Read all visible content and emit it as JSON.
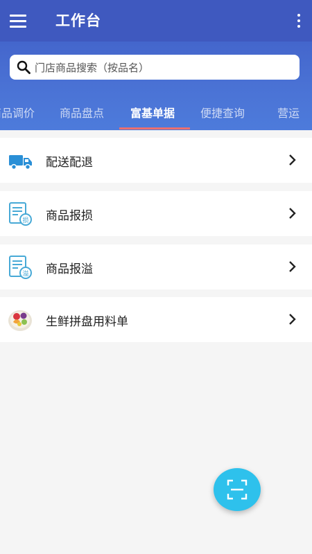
{
  "app_bar": {
    "title": "工作台",
    "menu_icon": "hamburger-menu-icon",
    "more_icon": "more-vertical-icon"
  },
  "search": {
    "placeholder": "门店商品搜索（按品名）",
    "icon": "search-icon"
  },
  "tabs": [
    {
      "label": "商品调价",
      "active": false
    },
    {
      "label": "商品盘点",
      "active": false
    },
    {
      "label": "富基单据",
      "active": true
    },
    {
      "label": "便捷查询",
      "active": false
    },
    {
      "label": "营运",
      "active": false
    }
  ],
  "menu_items": [
    {
      "label": "配送配退",
      "icon": "delivery-truck-icon"
    },
    {
      "label": "商品报损",
      "icon": "document-loss-icon"
    },
    {
      "label": "商品报溢",
      "icon": "document-overflow-icon"
    },
    {
      "label": "生鲜拼盘用料单",
      "icon": "fruit-platter-icon"
    }
  ],
  "doc_icon_badges": {
    "loss": "损",
    "overflow": "溢"
  },
  "fab": {
    "icon": "scan-icon"
  },
  "colors": {
    "app_bar": "#3f59bf",
    "header_band": "#4b74d6",
    "tab_indicator": "#ec6f6f",
    "fab": "#2ec1ec",
    "icon_blue": "#2a8fd6"
  }
}
